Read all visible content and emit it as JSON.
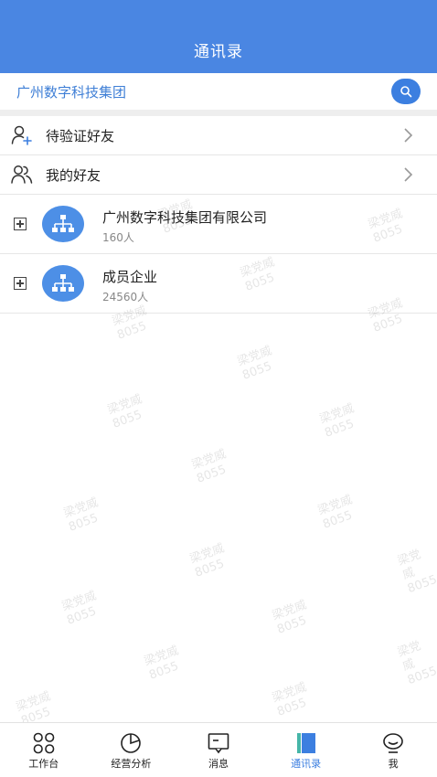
{
  "header": {
    "title": "通讯录"
  },
  "search": {
    "org_name": "广州数字科技集团",
    "icon": "search-icon"
  },
  "list": [
    {
      "label": "待验证好友",
      "icon": "add-user-icon"
    },
    {
      "label": "我的好友",
      "icon": "users-icon"
    }
  ],
  "orgs": [
    {
      "name": "广州数字科技集团有限公司",
      "count": "160人",
      "icon": "org-chart-icon"
    },
    {
      "name": "成员企业",
      "count": "24560人",
      "icon": "org-chart-icon"
    }
  ],
  "watermark": {
    "name": "梁党威",
    "code": "8055"
  },
  "tabs": [
    {
      "label": "工作台",
      "icon": "grid-icon",
      "active": false
    },
    {
      "label": "经营分析",
      "icon": "pie-chart-icon",
      "active": false
    },
    {
      "label": "消息",
      "icon": "message-icon",
      "active": false
    },
    {
      "label": "通讯录",
      "icon": "contacts-icon",
      "active": true
    },
    {
      "label": "我",
      "icon": "profile-icon",
      "active": false
    }
  ],
  "colors": {
    "accent": "#4a86e2",
    "active_tab": "#3c7fe0"
  }
}
